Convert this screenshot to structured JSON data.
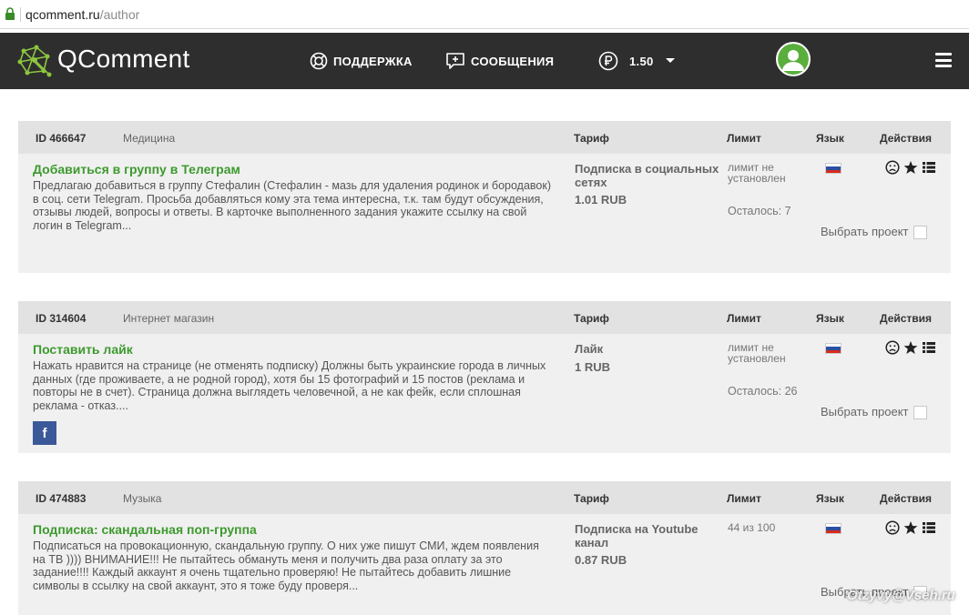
{
  "address_bar": {
    "host": "qcomment.ru",
    "path": "/author"
  },
  "header": {
    "brand": "QComment",
    "nav": {
      "support": "ПОДДЕРЖКА",
      "messages": "СООБЩЕНИЯ",
      "balance": "1.50"
    }
  },
  "table_headers": {
    "tariff": "Тариф",
    "limit": "Лимит",
    "language": "Язык",
    "actions": "Действия"
  },
  "tasks": [
    {
      "id": "ID 466647",
      "category": "Медицина",
      "title": "Добавиться в группу в Телеграм",
      "description": "Предлагаю добавиться в группу Стефалин (Стефалин - мазь для удаления родинок и бородавок) в соц. сети Telegram. Просьба добавляться кому эта тема интересна, т.к. там будут обсуждения, отзывы людей, вопросы и ответы. В карточке выполненного задания укажите ссылку на свой логин в Telegram...",
      "tariff": "Подписка в социальных сетях",
      "price": "1.01 RUB",
      "limit": "лимит не установлен",
      "remaining": "Осталось: 7",
      "choose": "Выбрать проект"
    },
    {
      "id": "ID 314604",
      "category": "Интернет магазин",
      "title": "Поставить лайк",
      "description": "Нажать нравится на странице (не отменять подписку) Должны быть украинские города в личных данных (где проживаете, а не родной город), хотя бы 15 фотографий и 15 постов (реклама и повторы не в счет). Страница должна выглядеть человечной, а не как фейк, если сплошная реклама - отказ....",
      "tariff": "Лайк",
      "price": "1 RUB",
      "limit": "лимит не установлен",
      "remaining": "Осталось: 26",
      "choose": "Выбрать проект",
      "social": "f"
    },
    {
      "id": "ID 474883",
      "category": "Музыка",
      "title": "Подписка: скандальная поп-группа",
      "description": "Подписаться на провокационную, скандальную группу. О них уже пишут СМИ, ждем появления на ТВ )))) ВНИМАНИЕ!!! Не пытайтесь обмануть меня и получить два раза оплату за это задание!!!! Каждый аккаунт я очень тщательно проверяю! Не пытайтесь добавить лишние символы в ссылку на свой аккаунт, это я тоже буду проверя...",
      "tariff": "Подписка на Youtube канал",
      "price": "0.87 RUB",
      "limit": "44 из 100",
      "choose": "Выбрать проект"
    }
  ],
  "watermark": "Otzyvy@Vseh.ru",
  "colors": {
    "header_bg": "#2e2e2e",
    "title_green": "#3d9a2e",
    "card_bg": "#f0f0f0",
    "card_head_bg": "#e2e2e2"
  },
  "icons": [
    "lock-icon",
    "logo-icon",
    "support-icon",
    "messages-icon",
    "ruble-icon",
    "chevron-down-icon",
    "avatar",
    "menu-icon",
    "russia-flag-icon",
    "sad-face-icon",
    "star-icon",
    "list-icon",
    "facebook-icon"
  ]
}
